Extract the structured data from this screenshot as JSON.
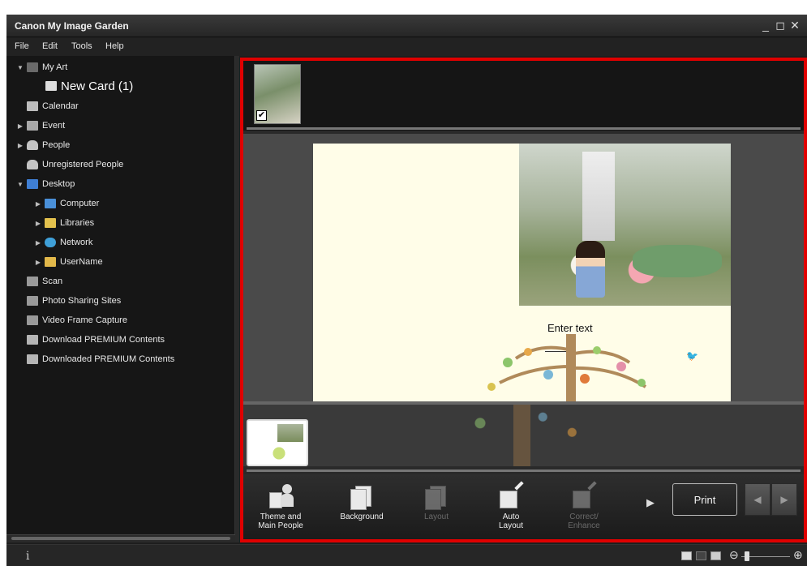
{
  "window": {
    "title": "Canon My Image Garden",
    "controls": {
      "minimize": "_",
      "restore": "◻",
      "close": "✕"
    }
  },
  "menu": [
    "File",
    "Edit",
    "Tools",
    "Help"
  ],
  "sidebar": {
    "items": [
      {
        "label": "My Art",
        "icon": "my-art-icon",
        "arrow": "▼"
      },
      {
        "label": "New Card (1)",
        "icon": "card-icon"
      },
      {
        "label": "Calendar",
        "icon": "calendar-icon"
      },
      {
        "label": "Event",
        "icon": "event-icon",
        "arrow": "▶"
      },
      {
        "label": "People",
        "icon": "people-icon",
        "arrow": "▶"
      },
      {
        "label": "Unregistered People",
        "icon": "person-icon"
      },
      {
        "label": "Desktop",
        "icon": "desktop-icon",
        "arrow": "▼"
      },
      {
        "label": "Computer",
        "icon": "computer-icon",
        "arrow": "▶"
      },
      {
        "label": "Libraries",
        "icon": "libraries-icon",
        "arrow": "▶"
      },
      {
        "label": "Network",
        "icon": "network-icon",
        "arrow": "▶"
      },
      {
        "label": "UserName",
        "icon": "user-folder-icon",
        "arrow": "▶"
      },
      {
        "label": "Scan",
        "icon": "scan-icon"
      },
      {
        "label": "Photo Sharing Sites",
        "icon": "photo-sharing-icon"
      },
      {
        "label": "Video Frame Capture",
        "icon": "video-capture-icon"
      },
      {
        "label": "Download PREMIUM Contents",
        "icon": "download-icon"
      },
      {
        "label": "Downloaded PREMIUM Contents",
        "icon": "folder-icon"
      }
    ]
  },
  "editor": {
    "top_thumbnail_checked": "✔",
    "card_text": "Enter text"
  },
  "toolbar": {
    "tools": [
      {
        "label_line1": "Theme and",
        "label_line2": "Main People",
        "enabled": true
      },
      {
        "label_line1": "Background",
        "label_line2": "",
        "enabled": true
      },
      {
        "label_line1": "Layout",
        "label_line2": "",
        "enabled": false
      },
      {
        "label_line1": "Auto",
        "label_line2": "Layout",
        "enabled": true
      },
      {
        "label_line1": "Correct/",
        "label_line2": "Enhance",
        "enabled": false
      }
    ],
    "more_arrow": "▶",
    "print": "Print",
    "prev": "◀",
    "next": "▶"
  },
  "statusbar": {
    "info": "i",
    "zoom_out": "⊖",
    "zoom_in": "⊕",
    "zoom_level": 0.12
  },
  "colors": {
    "highlight_border": "#e00000",
    "background": "#1e1e1e"
  }
}
